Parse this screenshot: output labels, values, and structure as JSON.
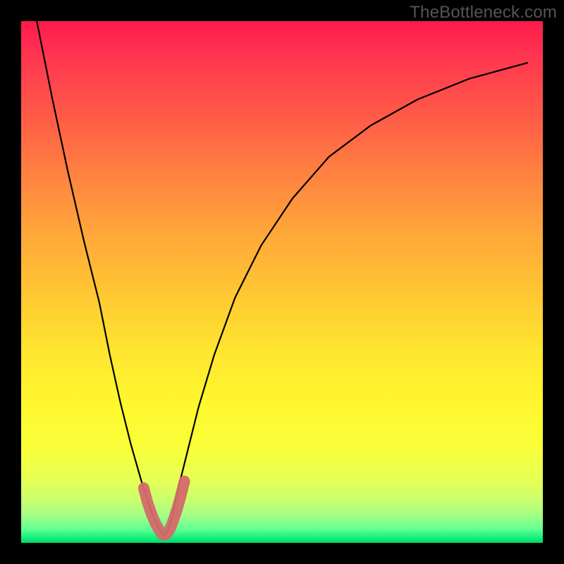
{
  "watermark": "TheBottleneck.com",
  "chart_data": {
    "type": "line",
    "title": "",
    "xlabel": "",
    "ylabel": "",
    "xlim": [
      0,
      100
    ],
    "ylim": [
      0,
      100
    ],
    "series": [
      {
        "name": "curve",
        "x": [
          3,
          6,
          9,
          12,
          15,
          17,
          19,
          21,
          23,
          25,
          26.5,
          27.4,
          28,
          29,
          30,
          32,
          34,
          37,
          41,
          46,
          52,
          59,
          67,
          76,
          86,
          97
        ],
        "values": [
          100,
          85,
          71,
          58,
          46,
          36,
          27,
          19,
          12,
          6,
          2.5,
          1.5,
          2,
          5,
          10,
          18,
          26,
          36,
          47,
          57,
          66,
          74,
          80,
          85,
          89,
          92
        ]
      },
      {
        "name": "highlight",
        "x": [
          23.5,
          24.2,
          25.0,
          25.8,
          26.5,
          27.0,
          27.4,
          28.0,
          28.6,
          29.2,
          29.9,
          30.6,
          31.3
        ],
        "values": [
          10.5,
          7.8,
          5.5,
          3.6,
          2.4,
          1.7,
          1.5,
          1.8,
          2.8,
          4.4,
          6.5,
          9.0,
          11.8
        ]
      }
    ],
    "colors": {
      "curve": "#000000",
      "highlight": "#d46a6a"
    }
  }
}
